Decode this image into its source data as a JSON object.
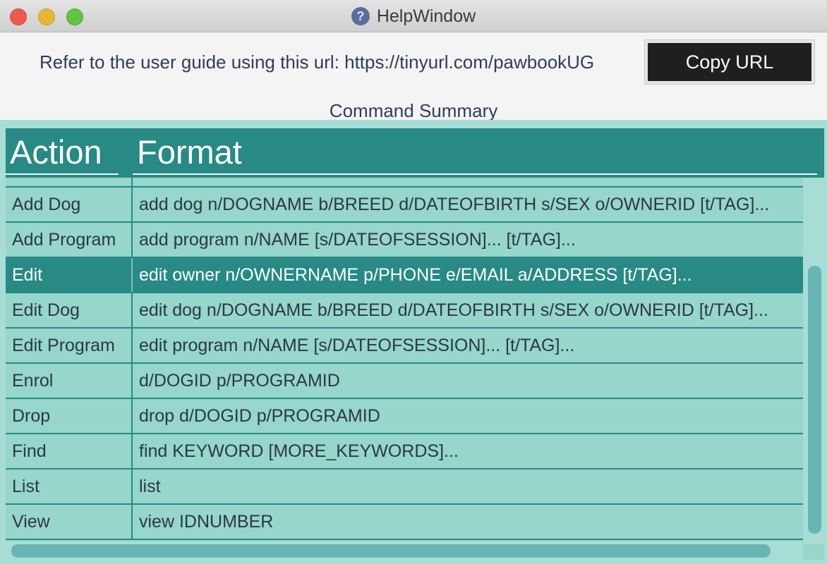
{
  "window": {
    "title": "HelpWindow",
    "title_icon": "?"
  },
  "header": {
    "url_text": "Refer to the user guide using this url: https://tinyurl.com/pawbookUG",
    "copy_button": "Copy URL",
    "section_title": "Command Summary"
  },
  "table": {
    "columns": [
      "Action",
      "Format"
    ],
    "selected_row": "Edit",
    "rows": [
      {
        "action": "Add Dog",
        "format": "add dog n/DOGNAME b/BREED d/DATEOFBIRTH s/SEX o/OWNERID [t/TAG]..."
      },
      {
        "action": "Add Program",
        "format": "add program n/NAME [s/DATEOFSESSION]... [t/TAG]..."
      },
      {
        "action": "Edit",
        "format": "edit owner n/OWNERNAME p/PHONE e/EMAIL a/ADDRESS [t/TAG]..."
      },
      {
        "action": "Edit Dog",
        "format": "edit dog n/DOGNAME b/BREED d/DATEOFBIRTH s/SEX o/OWNERID [t/TAG]..."
      },
      {
        "action": "Edit Program",
        "format": "edit program n/NAME [s/DATEOFSESSION]... [t/TAG]..."
      },
      {
        "action": "Enrol",
        "format": "d/DOGID p/PROGRAMID"
      },
      {
        "action": "Drop",
        "format": "drop d/DOGID p/PROGRAMID"
      },
      {
        "action": "Find",
        "format": "find KEYWORD [MORE_KEYWORDS]..."
      },
      {
        "action": "List",
        "format": "list"
      },
      {
        "action": "View",
        "format": "view IDNUMBER"
      }
    ]
  },
  "colors": {
    "accent": "#288985",
    "row_background": "#96d6cb",
    "text": "#2c3748"
  }
}
